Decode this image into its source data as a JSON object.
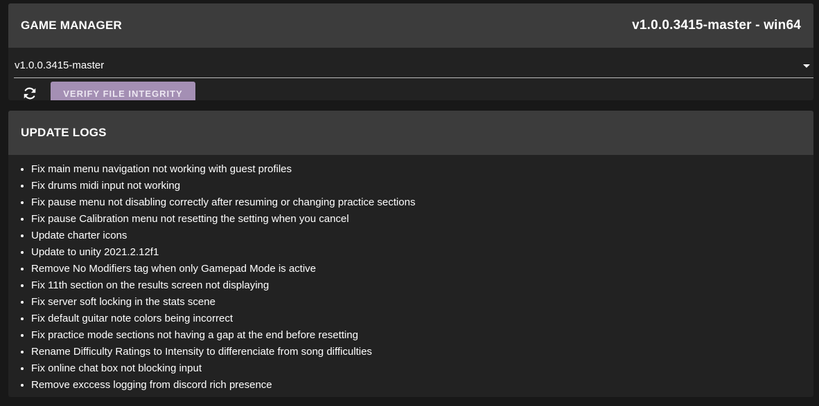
{
  "game_manager": {
    "title": "GAME MANAGER",
    "version_label": "v1.0.0.3415-master - win64",
    "version_select": {
      "value": "v1.0.0.3415-master"
    },
    "refresh_icon": "refresh-icon",
    "verify_button_label": "VERIFY FILE INTEGRITY"
  },
  "update_logs": {
    "title": "UPDATE LOGS",
    "items": [
      "Fix main menu navigation not working with guest profiles",
      "Fix drums midi input not working",
      "Fix pause menu not disabling correctly after resuming or changing practice sections",
      "Fix pause Calibration menu not resetting the setting when you cancel",
      "Update charter icons",
      "Update to unity 2021.2.12f1",
      "Remove No Modifiers tag when only Gamepad Mode is active",
      "Fix 11th section on the results screen not displaying",
      "Fix server soft locking in the stats scene",
      "Fix default guitar note colors being incorrect",
      "Fix practice mode sections not having a gap at the end before resetting",
      "Rename Difficulty Ratings to Intensity to differenciate from song difficulties",
      "Fix online chat box not blocking input",
      "Remove exccess logging from discord rich presence"
    ]
  },
  "colors": {
    "background": "#181818",
    "card": "#222222",
    "header": "#3c3c3c",
    "accent_button": "#a48fb4"
  }
}
